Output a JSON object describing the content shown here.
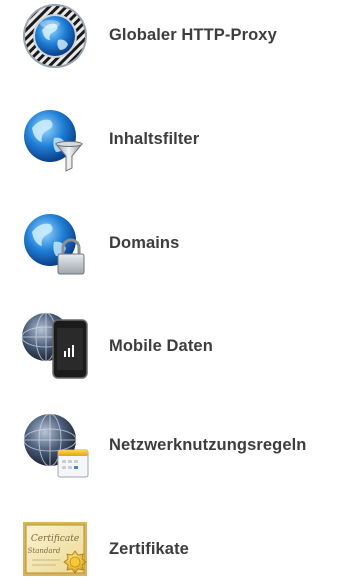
{
  "settings_list": {
    "items": [
      {
        "id": "global-http-proxy",
        "label": "Globaler HTTP-Proxy",
        "icon": "globe-striped-ring-icon"
      },
      {
        "id": "content-filter",
        "label": "Inhaltsfilter",
        "icon": "globe-funnel-icon"
      },
      {
        "id": "domains",
        "label": "Domains",
        "icon": "globe-lock-icon"
      },
      {
        "id": "cellular",
        "label": "Mobile Daten",
        "icon": "globe-phone-signal-icon"
      },
      {
        "id": "network-usage-rules",
        "label": "Netzwerknutzungsregeln",
        "icon": "globe-calendar-icon"
      },
      {
        "id": "certificates",
        "label": "Zertifikate",
        "icon": "certificate-icon"
      }
    ],
    "certificate_icon_text": [
      "Certificate",
      "Standard"
    ]
  }
}
